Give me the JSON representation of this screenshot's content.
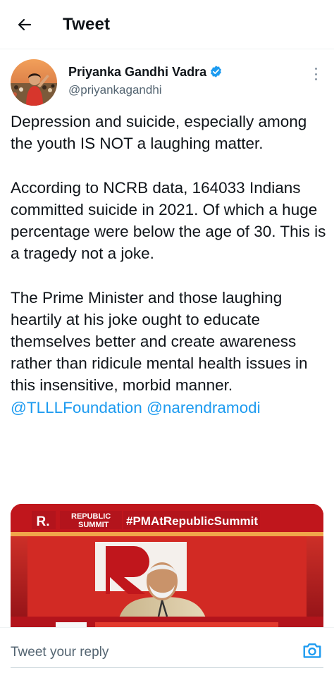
{
  "header": {
    "title": "Tweet",
    "back_icon": "arrow-left-icon"
  },
  "tweet": {
    "author": {
      "name": "Priyanka Gandhi Vadra",
      "handle": "@priyankagandhi",
      "verified": true,
      "verified_color": "#1d9bf0"
    },
    "paragraphs": [
      "Depression and suicide, especially among the youth IS NOT a laughing matter.",
      "According to NCRB data, 164033 Indians committed suicide in 2021. Of which a huge percentage were below the age of 30. This is a tragedy not a joke.",
      "The Prime Minister and those laughing heartily at his joke ought to educate themselves better and create awareness rather than ridicule mental health issues in this insensitive, morbid manner."
    ],
    "mentions": [
      "@TLLLFoundation",
      "@narendramodi"
    ],
    "link_color": "#1d9bf0",
    "media": {
      "logo_letter": "R.",
      "event_line1": "REPUBLIC",
      "event_line2": "SUMMIT",
      "hashtag": "#PMAtRepublicSummit",
      "backdrop_letter": "R"
    }
  },
  "reply": {
    "placeholder": "Tweet your reply",
    "camera_icon": "camera-icon"
  },
  "colors": {
    "text": "#0f1419",
    "secondary": "#536471",
    "accent": "#1d9bf0",
    "media_red": "#b3141c"
  }
}
